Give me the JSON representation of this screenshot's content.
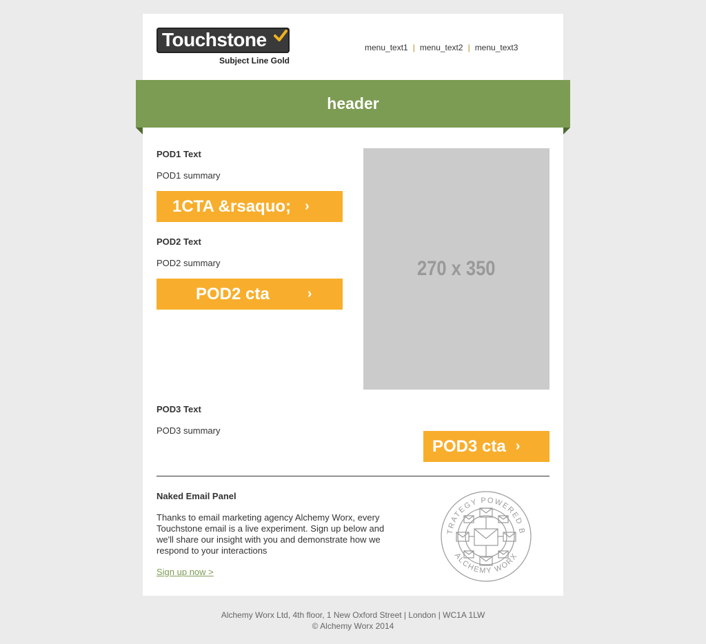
{
  "brand": {
    "logo_text": "Touchstone",
    "logo_sub": "Subject Line Gold",
    "accent_green": "#7d9c53",
    "accent_orange": "#f8ae2c",
    "tick_color": "#f0b21f"
  },
  "menu": {
    "items": [
      "menu_text1",
      "menu_text2",
      "menu_text3"
    ],
    "separator": "|"
  },
  "header": {
    "title": "header"
  },
  "pods": [
    {
      "title": "POD1 Text",
      "summary": "POD1 summary",
      "cta": "1CTA &rsaquo;",
      "cta_icon": "chevron-right-icon"
    },
    {
      "title": "POD2 Text",
      "summary": "POD2 summary",
      "cta": "POD2 cta",
      "cta_icon": "chevron-right-icon"
    },
    {
      "title": "POD3 Text",
      "summary": "POD3 summary",
      "cta": "POD3 cta",
      "cta_icon": "chevron-right-icon"
    }
  ],
  "image_placeholder": {
    "label": "270 x 350"
  },
  "naked_panel": {
    "title": "Naked Email Panel",
    "body": "Thanks to email marketing agency Alchemy Worx, every Touchstone email is a live experiment. Sign up below and we'll share our insight with you and demonstrate how we respond to your interactions",
    "signup_link": "Sign up now >",
    "seal_top_text": "STRATEGY POWERED BY",
    "seal_bottom_text": "ALCHEMY WORX"
  },
  "footer": {
    "address": "Alchemy Worx Ltd, 4th floor, 1 New Oxford Street | London | WC1A 1LW",
    "copyright": "© Alchemy Worx 2014"
  }
}
